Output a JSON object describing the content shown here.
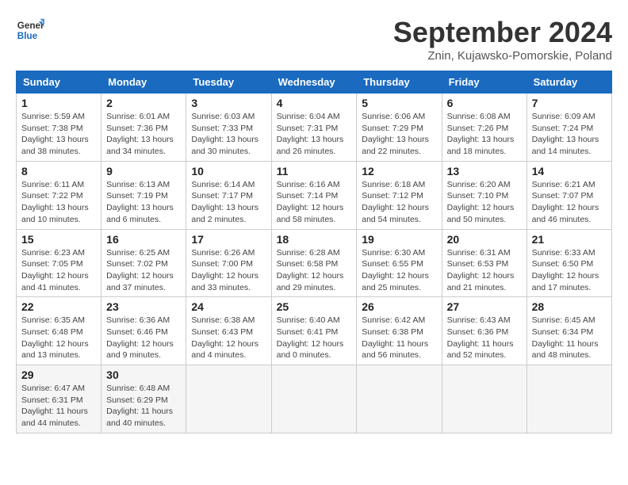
{
  "header": {
    "logo_line1": "General",
    "logo_line2": "Blue",
    "month_title": "September 2024",
    "location": "Znin, Kujawsko-Pomorskie, Poland"
  },
  "weekdays": [
    "Sunday",
    "Monday",
    "Tuesday",
    "Wednesday",
    "Thursday",
    "Friday",
    "Saturday"
  ],
  "weeks": [
    [
      {
        "day": "1",
        "sunrise": "Sunrise: 5:59 AM",
        "sunset": "Sunset: 7:38 PM",
        "daylight": "Daylight: 13 hours and 38 minutes."
      },
      {
        "day": "2",
        "sunrise": "Sunrise: 6:01 AM",
        "sunset": "Sunset: 7:36 PM",
        "daylight": "Daylight: 13 hours and 34 minutes."
      },
      {
        "day": "3",
        "sunrise": "Sunrise: 6:03 AM",
        "sunset": "Sunset: 7:33 PM",
        "daylight": "Daylight: 13 hours and 30 minutes."
      },
      {
        "day": "4",
        "sunrise": "Sunrise: 6:04 AM",
        "sunset": "Sunset: 7:31 PM",
        "daylight": "Daylight: 13 hours and 26 minutes."
      },
      {
        "day": "5",
        "sunrise": "Sunrise: 6:06 AM",
        "sunset": "Sunset: 7:29 PM",
        "daylight": "Daylight: 13 hours and 22 minutes."
      },
      {
        "day": "6",
        "sunrise": "Sunrise: 6:08 AM",
        "sunset": "Sunset: 7:26 PM",
        "daylight": "Daylight: 13 hours and 18 minutes."
      },
      {
        "day": "7",
        "sunrise": "Sunrise: 6:09 AM",
        "sunset": "Sunset: 7:24 PM",
        "daylight": "Daylight: 13 hours and 14 minutes."
      }
    ],
    [
      {
        "day": "8",
        "sunrise": "Sunrise: 6:11 AM",
        "sunset": "Sunset: 7:22 PM",
        "daylight": "Daylight: 13 hours and 10 minutes."
      },
      {
        "day": "9",
        "sunrise": "Sunrise: 6:13 AM",
        "sunset": "Sunset: 7:19 PM",
        "daylight": "Daylight: 13 hours and 6 minutes."
      },
      {
        "day": "10",
        "sunrise": "Sunrise: 6:14 AM",
        "sunset": "Sunset: 7:17 PM",
        "daylight": "Daylight: 13 hours and 2 minutes."
      },
      {
        "day": "11",
        "sunrise": "Sunrise: 6:16 AM",
        "sunset": "Sunset: 7:14 PM",
        "daylight": "Daylight: 12 hours and 58 minutes."
      },
      {
        "day": "12",
        "sunrise": "Sunrise: 6:18 AM",
        "sunset": "Sunset: 7:12 PM",
        "daylight": "Daylight: 12 hours and 54 minutes."
      },
      {
        "day": "13",
        "sunrise": "Sunrise: 6:20 AM",
        "sunset": "Sunset: 7:10 PM",
        "daylight": "Daylight: 12 hours and 50 minutes."
      },
      {
        "day": "14",
        "sunrise": "Sunrise: 6:21 AM",
        "sunset": "Sunset: 7:07 PM",
        "daylight": "Daylight: 12 hours and 46 minutes."
      }
    ],
    [
      {
        "day": "15",
        "sunrise": "Sunrise: 6:23 AM",
        "sunset": "Sunset: 7:05 PM",
        "daylight": "Daylight: 12 hours and 41 minutes."
      },
      {
        "day": "16",
        "sunrise": "Sunrise: 6:25 AM",
        "sunset": "Sunset: 7:02 PM",
        "daylight": "Daylight: 12 hours and 37 minutes."
      },
      {
        "day": "17",
        "sunrise": "Sunrise: 6:26 AM",
        "sunset": "Sunset: 7:00 PM",
        "daylight": "Daylight: 12 hours and 33 minutes."
      },
      {
        "day": "18",
        "sunrise": "Sunrise: 6:28 AM",
        "sunset": "Sunset: 6:58 PM",
        "daylight": "Daylight: 12 hours and 29 minutes."
      },
      {
        "day": "19",
        "sunrise": "Sunrise: 6:30 AM",
        "sunset": "Sunset: 6:55 PM",
        "daylight": "Daylight: 12 hours and 25 minutes."
      },
      {
        "day": "20",
        "sunrise": "Sunrise: 6:31 AM",
        "sunset": "Sunset: 6:53 PM",
        "daylight": "Daylight: 12 hours and 21 minutes."
      },
      {
        "day": "21",
        "sunrise": "Sunrise: 6:33 AM",
        "sunset": "Sunset: 6:50 PM",
        "daylight": "Daylight: 12 hours and 17 minutes."
      }
    ],
    [
      {
        "day": "22",
        "sunrise": "Sunrise: 6:35 AM",
        "sunset": "Sunset: 6:48 PM",
        "daylight": "Daylight: 12 hours and 13 minutes."
      },
      {
        "day": "23",
        "sunrise": "Sunrise: 6:36 AM",
        "sunset": "Sunset: 6:46 PM",
        "daylight": "Daylight: 12 hours and 9 minutes."
      },
      {
        "day": "24",
        "sunrise": "Sunrise: 6:38 AM",
        "sunset": "Sunset: 6:43 PM",
        "daylight": "Daylight: 12 hours and 4 minutes."
      },
      {
        "day": "25",
        "sunrise": "Sunrise: 6:40 AM",
        "sunset": "Sunset: 6:41 PM",
        "daylight": "Daylight: 12 hours and 0 minutes."
      },
      {
        "day": "26",
        "sunrise": "Sunrise: 6:42 AM",
        "sunset": "Sunset: 6:38 PM",
        "daylight": "Daylight: 11 hours and 56 minutes."
      },
      {
        "day": "27",
        "sunrise": "Sunrise: 6:43 AM",
        "sunset": "Sunset: 6:36 PM",
        "daylight": "Daylight: 11 hours and 52 minutes."
      },
      {
        "day": "28",
        "sunrise": "Sunrise: 6:45 AM",
        "sunset": "Sunset: 6:34 PM",
        "daylight": "Daylight: 11 hours and 48 minutes."
      }
    ],
    [
      {
        "day": "29",
        "sunrise": "Sunrise: 6:47 AM",
        "sunset": "Sunset: 6:31 PM",
        "daylight": "Daylight: 11 hours and 44 minutes."
      },
      {
        "day": "30",
        "sunrise": "Sunrise: 6:48 AM",
        "sunset": "Sunset: 6:29 PM",
        "daylight": "Daylight: 11 hours and 40 minutes."
      },
      null,
      null,
      null,
      null,
      null
    ]
  ]
}
